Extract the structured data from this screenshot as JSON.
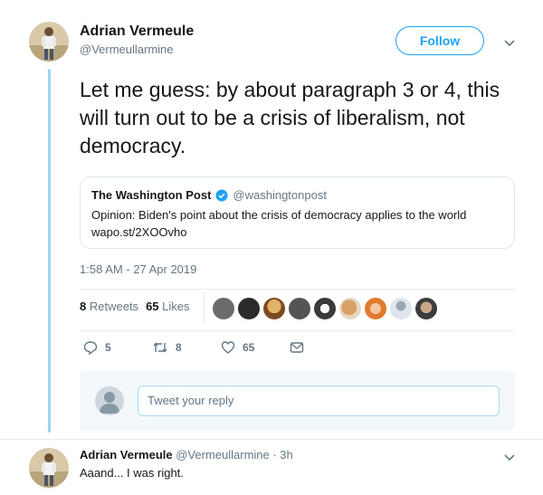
{
  "tweet": {
    "author": {
      "name": "Adrian Vermeule",
      "handle": "@Vermeullarmine"
    },
    "follow_label": "Follow",
    "text": "Let me guess: by about paragraph 3 or 4, this will turn out to be a crisis of liberalism, not democracy.",
    "quote": {
      "name": "The Washington Post",
      "handle": "@washingtonpost",
      "text": "Opinion: Biden's point about the crisis of democracy applies to the world",
      "link": "wapo.st/2XOOvho"
    },
    "timestamp": "1:58 AM - 27 Apr 2019",
    "stats": {
      "retweets_count": "8",
      "retweets_label": "Retweets",
      "likes_count": "65",
      "likes_label": "Likes"
    },
    "actions": {
      "replies": "5",
      "retweets": "8",
      "likes": "65"
    }
  },
  "reply_box": {
    "placeholder": "Tweet your reply"
  },
  "reply": {
    "name": "Adrian Vermeule",
    "handle_time": "@Vermeullarmine · 3h",
    "text": "Aaand... I was right."
  },
  "colors": {
    "accent": "#1da1f2",
    "thread_line": "#9fd3f5",
    "muted": "#657786"
  },
  "icons": [
    "chevron-down-icon",
    "verified-badge-icon",
    "reply-icon",
    "retweet-icon",
    "heart-icon",
    "message-icon"
  ]
}
